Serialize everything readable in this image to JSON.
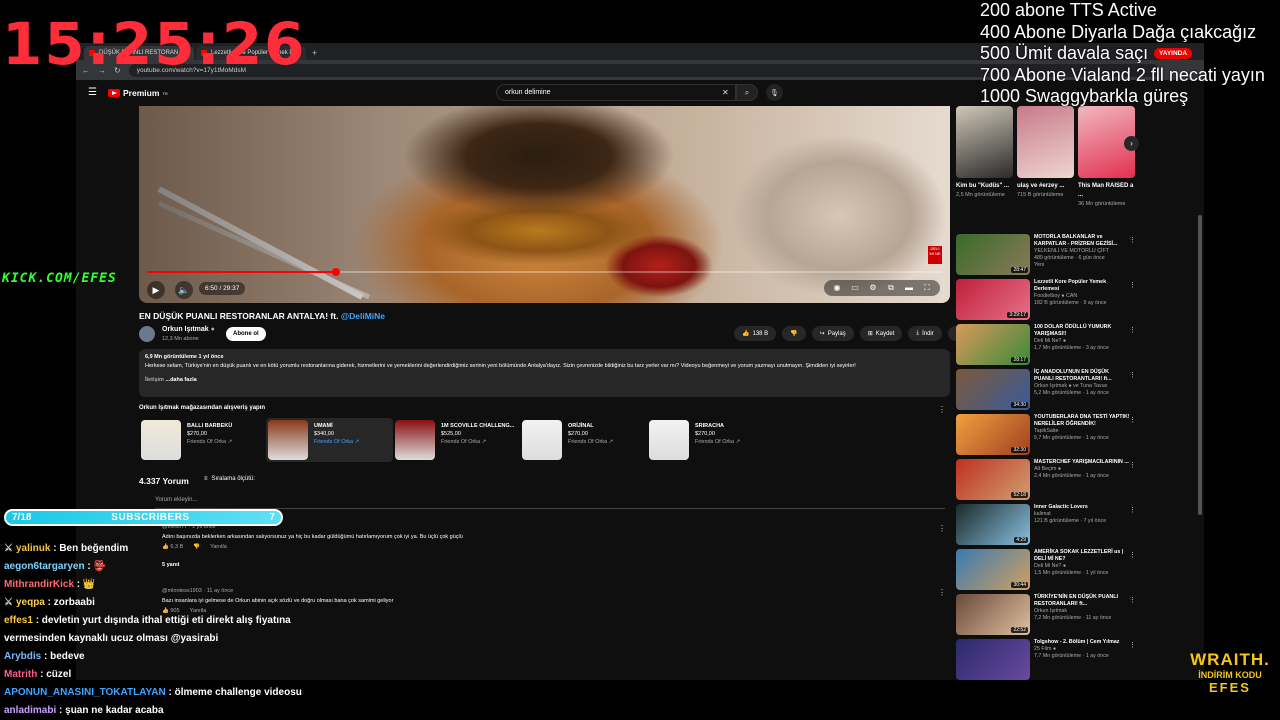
{
  "overlay": {
    "clock": "15:25:26",
    "goals": [
      "200 abone TTS Active",
      "400 Abone Diyarla Dağa çıakcağız",
      "500 Ümit davala saçı",
      "700 Abone Vialand 2 fll necati yayın",
      "1000 Swaggybarkla güreş"
    ],
    "kick": "KICK.COM/EFES",
    "subbar": {
      "left": "7/18",
      "label": "SUBSCRIBERS",
      "right": "7"
    },
    "chat": [
      {
        "user": "yalinuk",
        "color": "#f5c542",
        "badge": "⚔",
        "text": ": Ben beğendim"
      },
      {
        "user": "aegon6targaryen",
        "color": "#7fd4ff",
        "badge": "",
        "text": ": 👺"
      },
      {
        "user": "MithrandirKick",
        "color": "#ff6b6b",
        "badge": "",
        "text": ": 👑"
      },
      {
        "user": "yeqpa",
        "color": "#ffd24d",
        "badge": "⚔",
        "text": ": zorbaabi"
      },
      {
        "user": "effes1",
        "color": "#ffcc33",
        "badge": "",
        "text": ": devletin yurt dışında ithal ettiği eti direkt alış fiyatına"
      },
      {
        "user": "",
        "color": "#ffffff",
        "badge": "",
        "text": "vermesinden kaynaklı ucuz olması @yasirabi"
      },
      {
        "user": "Arybdis",
        "color": "#7fb8ff",
        "badge": "",
        "text": ": bedeve"
      },
      {
        "user": "Matrith",
        "color": "#ff5c8a",
        "badge": "",
        "text": ": cüzel"
      },
      {
        "user": "APONUN_ANASINI_TOKATLAYAN",
        "color": "#3ea6ff",
        "badge": "",
        "text": ": ölmeme challenge videosu"
      },
      {
        "user": "anladimabi",
        "color": "#c8a2ff",
        "badge": "",
        "text": ": şuan ne kadar acaba"
      }
    ],
    "wraith": {
      "brand": "WRAITH.",
      "code_label": "İNDİRİM KODU",
      "code": "EFES"
    }
  },
  "browser": {
    "tabs": [
      "DÜŞÜK PUANLI RESTORAN",
      "Lezzetli Kore Popüler Yemek D"
    ],
    "url": "youtube.com/watch?v=17y1tMoMdsM",
    "accent": "#ff0000"
  },
  "youtube": {
    "logo": "Premium",
    "logo_sup": "TR",
    "search_value": "orkun delimine",
    "live_badge": "YAYINDA",
    "video": {
      "time": "6:50 / 29:37",
      "progress": 0.238,
      "title": "EN DÜŞÜK PUANLI RESTORANLAR ANTALYA! ft.",
      "mention": "@DeliMiNe"
    },
    "channel": {
      "name": "Orkun Işıtmak",
      "subs": "12,3 Mn abone",
      "subscribe": "Abone ol"
    },
    "actions": [
      {
        "icon": "👍",
        "label": "138 B"
      },
      {
        "icon": "👎",
        "label": ""
      },
      {
        "icon": "↪",
        "label": "Paylaş"
      },
      {
        "icon": "⊞",
        "label": "Kaydet"
      },
      {
        "icon": "⤓",
        "label": "İndir"
      },
      {
        "icon": "⋯",
        "label": ""
      }
    ],
    "description": {
      "meta": "6,9 Mn görüntüleme  1 yıl önce",
      "text": "Herkese selam, Türkiye'nin en düşük puanlı ve en kötü yorumlu restoranlarına giderek, hizmetlerini ve yemeklerini değerlendirdiğimiz serinin yeni bölümünde Antalya'dayız. Sizin çevrenizde bildiğiniz bu tarz yerler var mı? Videoyu beğenmeyi ve yorum yazmayı unutmayın. Şimdiden iyi seyirler!",
      "extra": "İletişim",
      "more": "...daha fazla"
    },
    "shop": {
      "title": "Orkun Işıtmak mağazasından alışveriş yapın",
      "products": [
        {
          "name": "BALLI BARBEKÜ",
          "price": "$270,00",
          "seller": "Friends Of Orka ↗",
          "color": "#f0ead8"
        },
        {
          "name": "UMAMİ",
          "price": "$340,00",
          "seller": "Friends Of Orka ↗",
          "color": "#8a3a1a"
        },
        {
          "name": "1M SCOVILLE CHALLENG...",
          "price": "$525,00",
          "seller": "Friends Of Orka ↗",
          "color": "#8a1010"
        },
        {
          "name": "ORİJİNAL",
          "price": "$270,00",
          "seller": "Friends Of Orka ↗",
          "color": "#f2f2f2"
        },
        {
          "name": "SRIRACHA",
          "price": "$270,00",
          "seller": "Friends Of Orka ↗",
          "color": "#f2f2f2"
        }
      ]
    },
    "comments": {
      "count": "4.337 Yorum",
      "sort": "Sıralama ölçütü:",
      "placeholder": "Yorum ekleyin...",
      "items": [
        {
          "author": "@efes077 · 1 yıl önce",
          "text": "Adını başınızda beklerken arkasından salıyorsunuz  ya hiç bu kadar güldüğümü hatırlamıyorum çok iyi ya. Bu üçlü çok güçlü",
          "likes": "👍 6,3 B",
          "reply": "Yanıtla",
          "replies": "5 yanıt"
        },
        {
          "author": "@mlontess1903 · 11 ay önce",
          "text": "Bazı insanlara iyi gelmese de Orkun abinin açık sözlü ve doğru olması bana çok samimi geliyor",
          "likes": "👍 905",
          "reply": "Yanıtla",
          "replies": ""
        }
      ]
    },
    "shorts": [
      {
        "title": "Kim bu \"Kudüs\" ...",
        "views": "2,5 Mn görüntüleme",
        "color1": "#d0c8b8",
        "color2": "#2a2a2a"
      },
      {
        "title": "ulaş ve #erzey ...",
        "views": "715 B görüntüleme",
        "color1": "#c87a8a",
        "color2": "#eed6d0"
      },
      {
        "title": "This Man RAISED a ...",
        "views": "36 Mn görüntüleme",
        "color1": "#f0b8c0",
        "color2": "#e23050"
      }
    ],
    "recommended": [
      {
        "title": "MOTORLA BALKANLAR ve KARPATLAR - PRİZREN GEZİSİ...",
        "channel": "YELKENLİ VE MOTORLU ÇİFT",
        "meta": "489 görüntüleme · 6 gün önce",
        "extra": "Yeni",
        "dur": "28:47",
        "c1": "#3a6a2a",
        "c2": "#8a7a5a"
      },
      {
        "title": "Lezzetli Kore Popüler Yemek Derlemesi",
        "channel": "Foodielboy ● CAN",
        "meta": "182 B görüntüleme · 9 ay önce",
        "extra": "",
        "dur": "3:29:17",
        "c1": "#c0203a",
        "c2": "#e8708a"
      },
      {
        "title": "100 DOLAR ÖDÜLLÜ YUMURK YARIŞMASI!!",
        "channel": "Deli Mi Ne? ●",
        "meta": "1,7 Mn görüntüleme · 3 ay önce",
        "extra": "",
        "dur": "28:17",
        "c1": "#d89a5a",
        "c2": "#3a8a3a"
      },
      {
        "title": "İÇ ANADOLU'NUN EN DÜŞÜK PUANLI RESTORANTLARI! ft...",
        "channel": "Orkun Işıtmak ● ve Tuna Tavus",
        "meta": "5,2 Mn görüntüleme · 1 ay önce",
        "extra": "",
        "dur": "34:30",
        "c1": "#7a5a3a",
        "c2": "#3a5a9a"
      },
      {
        "title": "YOUTUBERLARA DNA TESTİ YAPTIK! NERELİLER ÖĞRENDİK!",
        "channel": "TapikSaite",
        "meta": "5,7 Mn görüntüleme · 1 ay önce",
        "extra": "",
        "dur": "32:30",
        "c1": "#f0a040",
        "c2": "#a04020"
      },
      {
        "title": "MASTERCHEF YARIŞMACILARININ ...",
        "channel": "Alt Beçim ●",
        "meta": "2,4 Mn görüntüleme · 1 ay önce",
        "extra": "",
        "dur": "52:18",
        "c1": "#c03020",
        "c2": "#d0a070"
      },
      {
        "title": "Inner Galactic Lovers",
        "channel": "kalimat",
        "meta": "121 B görüntüleme · 7 yıl önce",
        "extra": "",
        "dur": "4:29",
        "c1": "#1a2a2a",
        "c2": "#8ac0e0"
      },
      {
        "title": "AMERİKA SOKAK LEZZETLERİ us | DELİ Mİ NE?",
        "channel": "Deli Mi Ne? ●",
        "meta": "1,5 Mn görüntüleme · 1 yıl önce",
        "extra": "",
        "dur": "30:44",
        "c1": "#3a7ab0",
        "c2": "#d0a060"
      },
      {
        "title": "TÜRKİYE'NİN EN DÜŞÜK PUANLI RESTORANLARI! ft...",
        "channel": "Orkun Işıtmak",
        "meta": "7,2 Mn görüntüleme · 11 ay önce",
        "extra": "",
        "dur": "22:52",
        "c1": "#6a4a3a",
        "c2": "#e0c0a0"
      },
      {
        "title": "Tolgshow - 2. Bölüm | Cem Yılmaz",
        "channel": "25 Film ●",
        "meta": "7,7 Mn görüntüleme · 1 ay önce",
        "extra": "",
        "dur": "",
        "c1": "#2a2a6a",
        "c2": "#6a4aa0"
      }
    ]
  }
}
